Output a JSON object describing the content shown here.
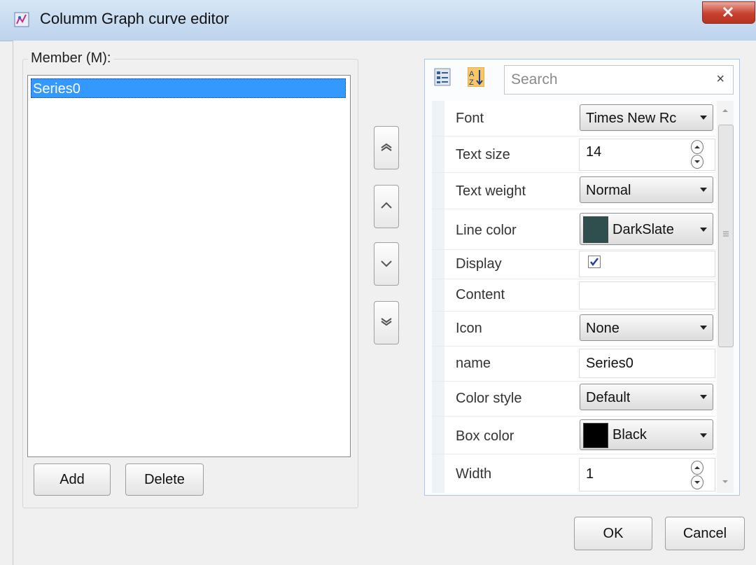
{
  "window": {
    "title": "Columm Graph curve editor"
  },
  "member_group": {
    "label": "Member (M):",
    "items": [
      "Series0"
    ],
    "add_label": "Add",
    "delete_label": "Delete"
  },
  "property_grid": {
    "search_placeholder": "Search",
    "clear_glyph": "×",
    "rows": [
      {
        "label": "Font",
        "type": "combo",
        "value": "Times New Rc"
      },
      {
        "label": "Text size",
        "type": "number",
        "value": "14"
      },
      {
        "label": "Text weight",
        "type": "combo",
        "value": "Normal"
      },
      {
        "label": "Line color",
        "type": "color",
        "value": "DarkSlate",
        "color": "#2f4f4f"
      },
      {
        "label": "Display",
        "type": "checkbox",
        "checked": true
      },
      {
        "label": "Content",
        "type": "text",
        "value": ""
      },
      {
        "label": "Icon",
        "type": "combo",
        "value": "None"
      },
      {
        "label": "name",
        "type": "text",
        "value": "Series0"
      },
      {
        "label": "Color style",
        "type": "combo",
        "value": "Default"
      },
      {
        "label": "Box color",
        "type": "color",
        "value": "Black",
        "color": "#000000"
      },
      {
        "label": "Width",
        "type": "number",
        "value": "1"
      }
    ]
  },
  "footer": {
    "ok_label": "OK",
    "cancel_label": "Cancel"
  },
  "colors": {
    "selection": "#3399ff",
    "title_bar": "#c8dcf0",
    "close_button": "#c9402e"
  }
}
